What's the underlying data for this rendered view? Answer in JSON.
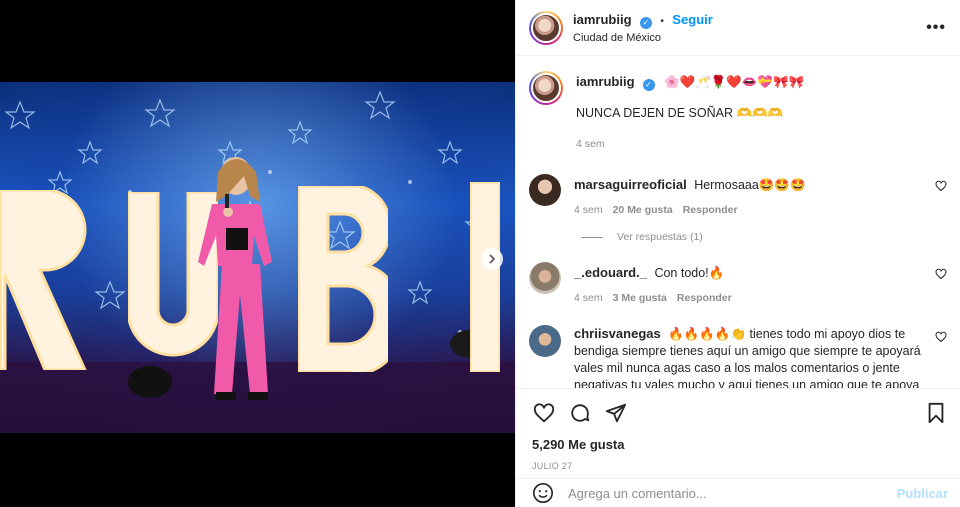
{
  "post": {
    "author": "iamrubiig",
    "follow_label": "Seguir",
    "location": "Ciudad de México",
    "more_label": "•••"
  },
  "caption": {
    "username": "iamrubiig",
    "emojis": "🌸❤️🥂🌹❤️👄💝🎀🎀",
    "text": "NUNCA DEJEN DE SOÑAR 🫶🫶🫶",
    "time": "4 sem"
  },
  "comments": [
    {
      "username": "marsaguirreoficial",
      "text": "Hermosaaa🤩🤩🤩",
      "time": "4 sem",
      "likes": "20 Me gusta",
      "reply_label": "Responder",
      "view_replies": "Ver respuestas (1)"
    },
    {
      "username": "_.edouard._",
      "text": "Con todo!🔥",
      "time": "4 sem",
      "likes": "3 Me gusta",
      "reply_label": "Responder"
    },
    {
      "username": "chriisvanegas",
      "text": "🔥🔥🔥🔥👏 tienes todo mi apoyo dios te bendiga siempre tienes aquí un amigo que siempre te apoyará vales mil nunca agas caso a los malos comentarios o jente negativas tu vales mucho y aqui tienes un amigo que te apoya"
    }
  ],
  "likes_total": "5,290 Me gusta",
  "date": "JULIO 27",
  "add_comment": {
    "placeholder": "Agrega un comentario...",
    "publish_label": "Publicar"
  },
  "image": {
    "letters": [
      "R",
      "U",
      "B",
      "I"
    ],
    "carousel_pages": 5,
    "active_page": 1
  },
  "colors": {
    "accent": "#0095f6",
    "verified": "#3897f0",
    "publish_disabled": "#b2dffc",
    "outfit_pink": "#f05aa8"
  }
}
